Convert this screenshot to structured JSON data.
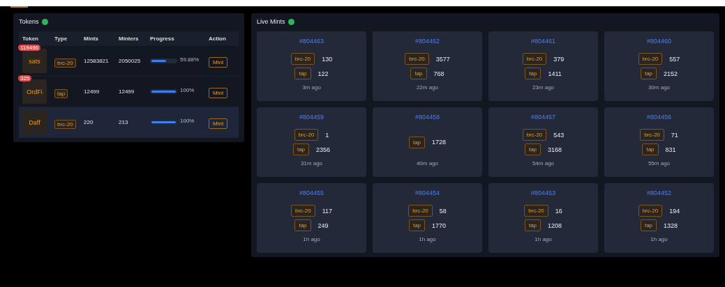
{
  "tokens": {
    "title": "Tokens",
    "live": true,
    "columns": [
      "Token",
      "Type",
      "Mints",
      "Minters",
      "Progress",
      "Action"
    ],
    "rows": [
      {
        "token": "sats",
        "badge": "119496",
        "type": "brc-20",
        "mints": "12583821",
        "minters": "2050025",
        "level": 0.5988,
        "progress": "59.88%",
        "action": "Mint",
        "selected": false
      },
      {
        "token": "OrdFi",
        "badge": "325",
        "type": "tap",
        "mints": "12499",
        "minters": "12499",
        "level": 1,
        "progress": "100%",
        "action": "Mint",
        "selected": false
      },
      {
        "token": "Daff",
        "type": "brc-20",
        "mints": "220",
        "minters": "213",
        "level": 1,
        "progress": "100%",
        "action": "Mint",
        "selected": true
      }
    ]
  },
  "live_mints": {
    "title": "Live Mints",
    "live": true,
    "cards": [
      {
        "id": "#804463",
        "mints": [
          {
            "type": "brc-20",
            "count": "130"
          },
          {
            "type": "tap",
            "count": "122"
          }
        ],
        "time": "3m ago"
      },
      {
        "id": "#804462",
        "mints": [
          {
            "type": "brc-20",
            "count": "3577"
          },
          {
            "type": "tap",
            "count": "768"
          }
        ],
        "time": "22m ago"
      },
      {
        "id": "#804461",
        "mints": [
          {
            "type": "brc-20",
            "count": "379"
          },
          {
            "type": "tap",
            "count": "1411"
          }
        ],
        "time": "23m ago"
      },
      {
        "id": "#804460",
        "mints": [
          {
            "type": "brc-20",
            "count": "557"
          },
          {
            "type": "tap",
            "count": "2152"
          }
        ],
        "time": "30m ago"
      },
      {
        "id": "#804459",
        "mints": [
          {
            "type": "brc-20",
            "count": "1"
          },
          {
            "type": "tap",
            "count": "2356"
          }
        ],
        "time": "31m ago"
      },
      {
        "id": "#804458",
        "mints": [
          {
            "type": "tap",
            "count": "1728"
          }
        ],
        "time": "40m ago"
      },
      {
        "id": "#804457",
        "mints": [
          {
            "type": "brc-20",
            "count": "543"
          },
          {
            "type": "tap",
            "count": "3168"
          }
        ],
        "time": "54m ago"
      },
      {
        "id": "#804456",
        "mints": [
          {
            "type": "brc-20",
            "count": "71"
          },
          {
            "type": "tap",
            "count": "831"
          }
        ],
        "time": "55m ago"
      },
      {
        "id": "#804455",
        "mints": [
          {
            "type": "brc-20",
            "count": "117"
          },
          {
            "type": "tap",
            "count": "249"
          }
        ],
        "time": "1h ago"
      },
      {
        "id": "#804454",
        "mints": [
          {
            "type": "brc-20",
            "count": "58"
          },
          {
            "type": "tap",
            "count": "1770"
          }
        ],
        "time": "1h ago"
      },
      {
        "id": "#804453",
        "mints": [
          {
            "type": "brc-20",
            "count": "16"
          },
          {
            "type": "tap",
            "count": "1208"
          }
        ],
        "time": "1h ago"
      },
      {
        "id": "#804452",
        "mints": [
          {
            "type": "brc-20",
            "count": "194"
          },
          {
            "type": "tap",
            "count": "1328"
          }
        ],
        "time": "1h ago"
      }
    ]
  }
}
